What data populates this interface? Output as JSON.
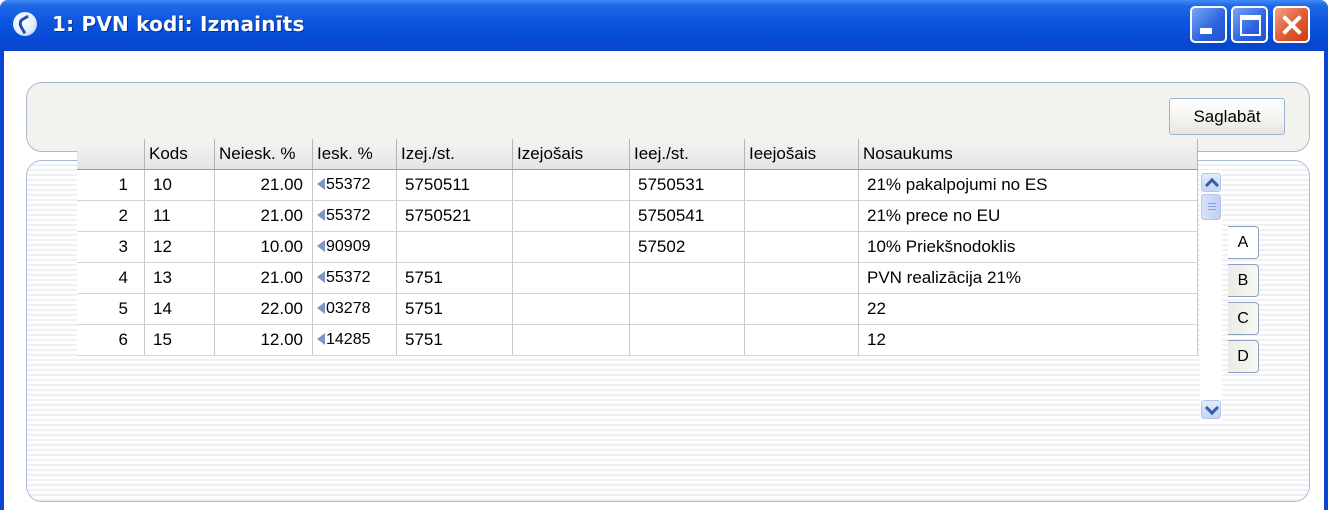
{
  "window": {
    "title": "1: PVN kodi: Izmainīts"
  },
  "toolbar": {
    "save_label": "Saglabāt"
  },
  "table": {
    "headers": [
      "",
      "Kods",
      "Neiesk. %",
      "Iesk. %",
      "Izej./st.",
      "Izejošais",
      "Ieej./st.",
      "Ieejošais",
      "Nosaukums"
    ],
    "rows": [
      [
        "1",
        "10",
        "21.00",
        "55372",
        "5750511",
        "",
        "5750531",
        "",
        "21% pakalpojumi no ES"
      ],
      [
        "2",
        "11",
        "21.00",
        "55372",
        "5750521",
        "",
        "5750541",
        "",
        "21% prece no EU"
      ],
      [
        "3",
        "12",
        "10.00",
        "90909",
        "",
        "",
        "57502",
        "",
        "10% Priekšnodoklis"
      ],
      [
        "4",
        "13",
        "21.00",
        "55372",
        "5751",
        "",
        "",
        "",
        "PVN realizācija 21%"
      ],
      [
        "5",
        "14",
        "22.00",
        "03278",
        "5751",
        "",
        "",
        "",
        "22"
      ],
      [
        "6",
        "15",
        "12.00",
        "14285",
        "5751",
        "",
        "",
        "",
        "12"
      ]
    ]
  },
  "tabs": [
    "A",
    "B",
    "C",
    "D"
  ],
  "active_tab": "A"
}
